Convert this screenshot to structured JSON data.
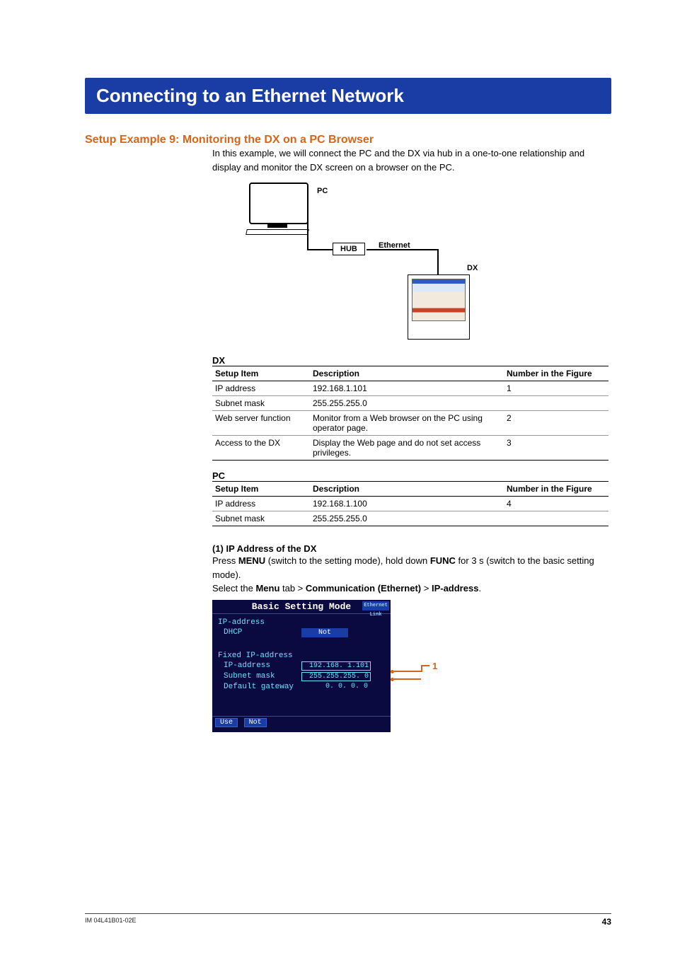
{
  "title": "Connecting to an Ethernet Network",
  "section": "Setup Example 9: Monitoring the DX on a PC Browser",
  "intro": "In this example, we will connect the PC and the DX via hub in a one-to-one relationship and display and monitor the DX screen on a browser on the PC.",
  "diagram": {
    "pc": "PC",
    "hub": "HUB",
    "ethernet": "Ethernet",
    "dx": "DX"
  },
  "dx": {
    "heading": "DX",
    "cols": {
      "item": "Setup Item",
      "desc": "Description",
      "num": "Number in the Figure"
    },
    "rows": [
      {
        "item": "IP address",
        "desc": "192.168.1.101",
        "num": "1"
      },
      {
        "item": "Subnet mask",
        "desc": "255.255.255.0",
        "num": ""
      },
      {
        "item": "Web server function",
        "desc": "Monitor from a Web browser on the PC using operator page.",
        "num": "2"
      },
      {
        "item": "Access to the DX",
        "desc": "Display the Web page and do not set access privileges.",
        "num": "3"
      }
    ]
  },
  "pc": {
    "heading": "PC",
    "cols": {
      "item": "Setup Item",
      "desc": "Description",
      "num": "Number in the Figure"
    },
    "rows": [
      {
        "item": "IP address",
        "desc": "192.168.1.100",
        "num": "4"
      },
      {
        "item": "Subnet mask",
        "desc": "255.255.255.0",
        "num": ""
      }
    ]
  },
  "step1": {
    "heading": "(1) IP Address of the DX",
    "line1a": "Press ",
    "menu": "MENU",
    "line1b": " (switch to the setting mode), hold down ",
    "func": "FUNC",
    "line1c": " for 3 s (switch to the basic setting mode).",
    "line2a": "Select the ",
    "menutab": "Menu",
    "line2b": " tab > ",
    "comm": "Communication (Ethernet)",
    "line2c": " > ",
    "ipaddr": "IP-address",
    "line2d": "."
  },
  "bsm": {
    "title": "Basic Setting Mode",
    "badge": "Ethernet Link",
    "ipaddress_lbl": "IP-address",
    "dhcp_lbl": "DHCP",
    "dhcp_val": "Not",
    "fixed_lbl": "Fixed IP-address",
    "ip_lbl": "IP-address",
    "ip_val": "192.168.  1.101",
    "sm_lbl": "Subnet mask",
    "sm_val": "255.255.255.  0",
    "gw_lbl": "Default gateway",
    "gw_val": "  0.  0.  0.  0",
    "btn_use": "Use",
    "btn_not": "Not",
    "callout": "1"
  },
  "footer": {
    "docid": "IM 04L41B01-02E",
    "page": "43"
  }
}
